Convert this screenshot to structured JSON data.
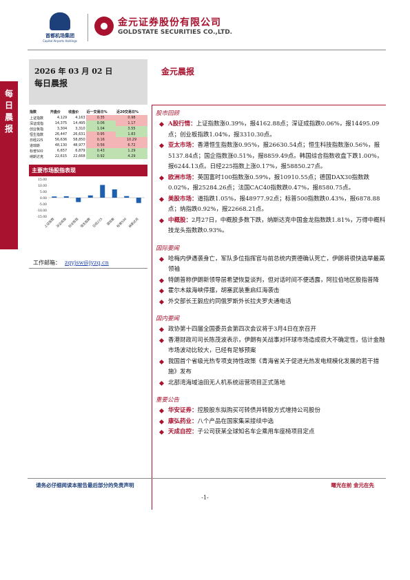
{
  "header": {
    "logo1_cn": "首都机场集团",
    "logo1_en": "Capital Airports Holdings",
    "logo2_cn": "金元证券股份有限公司",
    "logo2_en": "GOLDSTATE SECURITIES  CO.,LTD."
  },
  "side_tab": "每日晨报",
  "date": "2026 年 03 月 02 日",
  "subtitle": "每日晨报",
  "main_title": "金元晨报",
  "table": {
    "headers": [
      "指数",
      "开盘价",
      "收盘价",
      "近一交易日%",
      "近20交易日%"
    ],
    "rows": [
      {
        "name": "上证指数",
        "open": "4,129",
        "close": "4,163",
        "d1": "0.35",
        "d20": "0.98",
        "d1_sign": "pos",
        "d20_sign": "pos"
      },
      {
        "name": "深证成指",
        "open": "14,375",
        "close": "14,495",
        "d1": "0.06",
        "d20": "1.17",
        "d1_sign": "neg",
        "d20_sign": "pos"
      },
      {
        "name": "创业板指",
        "open": "3,304",
        "close": "3,310",
        "d1": "1.04",
        "d20": "3.55",
        "d1_sign": "neg",
        "d20_sign": "neg"
      },
      {
        "name": "恒生指数",
        "open": "26,447",
        "close": "26,631",
        "d1": "0.95",
        "d20": "1.83",
        "d1_sign": "pos",
        "d20_sign": "neg"
      },
      {
        "name": "日经225",
        "open": "56,636",
        "close": "58,850",
        "d1": "0.16",
        "d20": "10.29",
        "d1_sign": "pos",
        "d20_sign": "pos"
      },
      {
        "name": "道琼斯",
        "open": "48,130",
        "close": "48,977",
        "d1": "0.56",
        "d20": "6.72",
        "d1_sign": "pos",
        "d20_sign": "pos"
      },
      {
        "name": "标普500",
        "open": "6,657",
        "close": "6,879",
        "d1": "0.43",
        "d20": "1.29",
        "d1_sign": "neg",
        "d20_sign": "neg"
      },
      {
        "name": "纳斯达克",
        "open": "22,615",
        "close": "22,668",
        "d1": "0.92",
        "d20": "4.29",
        "d1_sign": "neg",
        "d20_sign": "neg"
      }
    ]
  },
  "chart_title": "主要市场股指表现",
  "chart_data": {
    "type": "bar",
    "categories": [
      "上证指数",
      "深证成指",
      "创业板指",
      "恒生指数",
      "日经225",
      "道琼斯",
      "标普500",
      "纳斯达克"
    ],
    "values": [
      0.98,
      1.17,
      -3.55,
      1.83,
      10.29,
      6.72,
      1.29,
      -4.29
    ],
    "ylim": [
      -15,
      15
    ],
    "yticks": [
      "15.00",
      "10.00",
      "5.00",
      "0.00",
      "-5.00",
      "-10.00",
      "-15.00"
    ],
    "bar_color": "#1f5fb0"
  },
  "contact": {
    "label": "工作邮箱：",
    "email": "zqyjsw@jyzq.cn"
  },
  "sections": [
    {
      "title": "股市回顾",
      "items": [
        {
          "lead": "A股行情：",
          "text": "上证指数涨0.39%，报4162.88点；深证成指跌0.06%，报14495.09点；创业板指跌1.04%，报3310.30点。"
        },
        {
          "lead": "亚太市场：",
          "text": "香港恒生指数涨0.95%，报26630.54点；恒生科技指数涨0.56%，报5137.84点；国企指数涨0.51%，报8859.49点。韩国综合指数收盘下跌1.00%，报6244.13点。日经225指数上涨0.17%，报58850.27点。"
        },
        {
          "lead": "欧洲市场：",
          "text": "英国富时100指数涨0.59%，报10910.55点；德国DAX30指数跌0.02%，报25284.26点；法国CAC40指数跌0.47%，报8580.75点。"
        },
        {
          "lead": "美股市场：",
          "text": "道指跌1.05%，报48977.92点；标普500指数跌0.43%，报6878.88点；纳指跌0.92%，报22668.21点。"
        },
        {
          "lead": "中概股：",
          "text": "2月27日，中概股多数下跌，纳斯达克中国金龙指数跌1.81%，万得中概科技龙头指数跌0.93%。"
        }
      ]
    },
    {
      "title": "国际要闻",
      "items": [
        {
          "lead": "",
          "text": "哈梅内伊遇袭身亡，军队多位指挥官与前总统内贾德确认死亡，伊朗将很快选举最高领袖"
        },
        {
          "lead": "",
          "text": "特朗普称伊朗新领导层希望恢复谈判，但对话时间不便透露，阿拉伯地区股指普降"
        },
        {
          "lead": "",
          "text": "霍尔木兹海峡停摆，胡塞武装重启红海袭击"
        },
        {
          "lead": "",
          "text": "外交部长王毅应约同俄罗斯外长拉夫罗夫通电话"
        }
      ]
    },
    {
      "title": "国内要闻",
      "items": [
        {
          "lead": "",
          "text": "政协第十四届全国委员会第四次会议将于3月4日在京召开"
        },
        {
          "lead": "",
          "text": "香港财政司司长陈茂波表示，伊朗有关战事对环球市场造成很大不确定性，估计金融市场波动比较大，已经有足够预案"
        },
        {
          "lead": "",
          "text": "我国首个省级光热专项支持性政策《青海省关于促进光热发电规模化发展的若干措施》发布"
        },
        {
          "lead": "",
          "text": "北部湾海域油田无人机系统运营项目正式落地"
        }
      ]
    },
    {
      "title": "重要公告",
      "items": [
        {
          "lead": "华安证券：",
          "text": "控股股东拟购买可转债并转股方式增持公司股份"
        },
        {
          "lead": "康弘药业：",
          "text": "八个产品在国家集采接续中选"
        },
        {
          "lead": "天成自控：",
          "text": "子公司获某全球知名车企乘用车座椅项目定点"
        }
      ]
    }
  ],
  "footer": {
    "left": "请务必仔细阅读本报告最后部分的免责声明",
    "right": "曙光在前  金元在先",
    "page": "-1-"
  }
}
